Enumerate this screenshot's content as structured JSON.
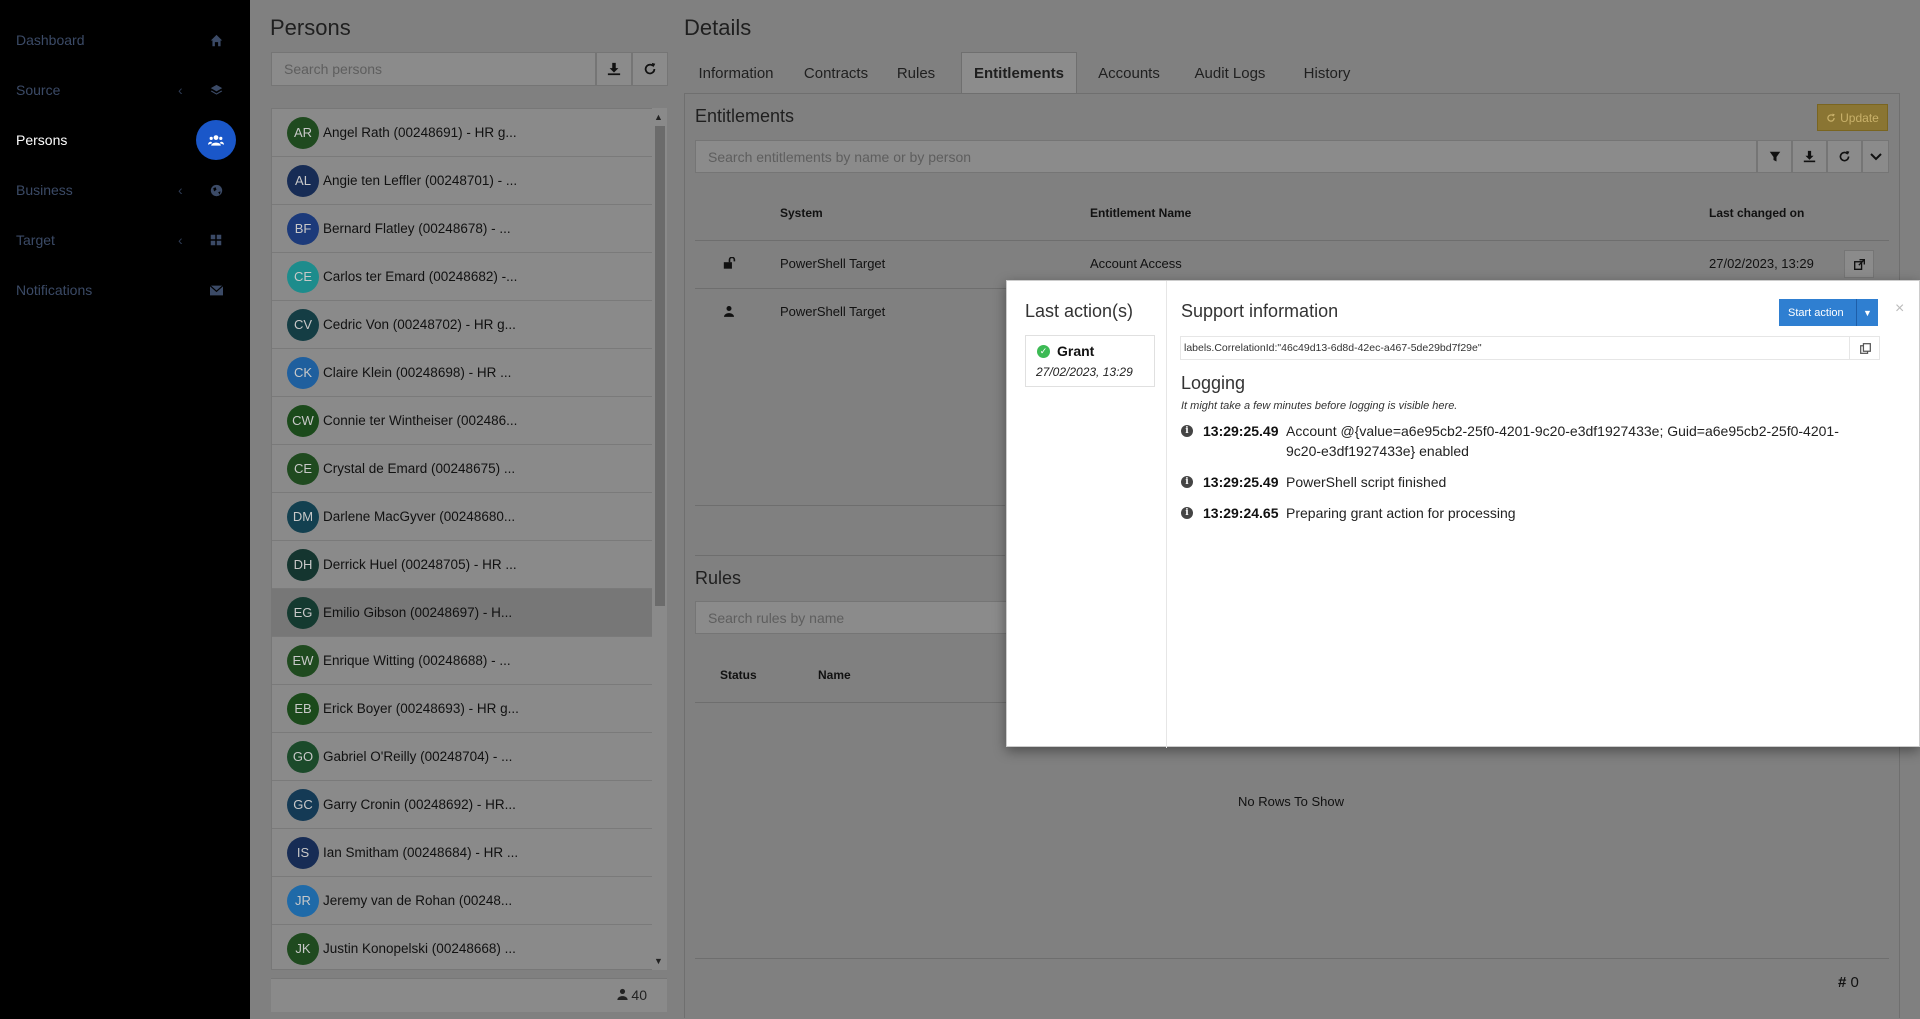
{
  "sidebar": {
    "items": [
      {
        "label": "Dashboard",
        "icon": "home-icon",
        "has_chevron": false
      },
      {
        "label": "Source",
        "icon": "layers-icon",
        "has_chevron": true
      },
      {
        "label": "Persons",
        "icon": "users-icon",
        "has_chevron": false,
        "active": true
      },
      {
        "label": "Business",
        "icon": "globe-icon",
        "has_chevron": true
      },
      {
        "label": "Target",
        "icon": "grid-icon",
        "has_chevron": true
      },
      {
        "label": "Notifications",
        "icon": "envelope-icon",
        "has_chevron": false
      }
    ],
    "chevron": "‹"
  },
  "persons": {
    "title": "Persons",
    "search_placeholder": "Search persons",
    "count": "40",
    "list": [
      {
        "initials": "AR",
        "name": "Angel Rath (00248691) - HR g...",
        "color": "#1f4a1f"
      },
      {
        "initials": "AL",
        "name": "Angie ten Leffler (00248701) - ...",
        "color": "#172c55"
      },
      {
        "initials": "BF",
        "name": "Bernard Flatley (00248678) - ...",
        "color": "#1c3a7a"
      },
      {
        "initials": "CE",
        "name": "Carlos ter Emard (00248682) -...",
        "color": "#1d8c8c"
      },
      {
        "initials": "CV",
        "name": "Cedric Von (00248702) - HR g...",
        "color": "#143d44"
      },
      {
        "initials": "CK",
        "name": "Claire Klein (00248698) - HR ...",
        "color": "#1f5f9e"
      },
      {
        "initials": "CW",
        "name": "Connie ter Wintheiser (002486...",
        "color": "#1b4a1b"
      },
      {
        "initials": "CE",
        "name": "Crystal de Emard (00248675) ...",
        "color": "#1f4a1f"
      },
      {
        "initials": "DM",
        "name": "Darlene MacGyver (00248680...",
        "color": "#134050"
      },
      {
        "initials": "DH",
        "name": "Derrick Huel (00248705) - HR ...",
        "color": "#14352f"
      },
      {
        "initials": "EG",
        "name": "Emilio Gibson (00248697) - H...",
        "color": "#143a30",
        "selected": true
      },
      {
        "initials": "EW",
        "name": "Enrique Witting (00248688) - ...",
        "color": "#1f4a1f"
      },
      {
        "initials": "EB",
        "name": "Erick Boyer (00248693) - HR g...",
        "color": "#1b4a1b"
      },
      {
        "initials": "GO",
        "name": "Gabriel O'Reilly (00248704) - ...",
        "color": "#1b4a2a"
      },
      {
        "initials": "GC",
        "name": "Garry Cronin (00248692) - HR...",
        "color": "#143a55"
      },
      {
        "initials": "IS",
        "name": "Ian Smitham (00248684) - HR ...",
        "color": "#172c55"
      },
      {
        "initials": "JR",
        "name": "Jeremy van de Rohan (00248...",
        "color": "#1f6aa8"
      },
      {
        "initials": "JK",
        "name": "Justin Konopelski (00248668) ...",
        "color": "#1f4a1f"
      }
    ]
  },
  "details": {
    "title": "Details",
    "tabs": [
      "Information",
      "Contracts",
      "Rules",
      "Entitlements",
      "Accounts",
      "Audit Logs",
      "History"
    ],
    "active_tab": "Entitlements",
    "entitlements": {
      "title": "Entitlements",
      "update_label": "Update",
      "search_placeholder": "Search entitlements by name or by person",
      "columns": [
        "System",
        "Entitlement Name",
        "Last changed on"
      ],
      "rows": [
        {
          "icon": "unlock-icon",
          "system": "PowerShell Target",
          "name": "Account Access",
          "changed": "27/02/2023, 13:29"
        },
        {
          "icon": "user-icon",
          "system": "PowerShell Target",
          "name": "",
          "changed": ""
        }
      ]
    },
    "rules": {
      "title": "Rules",
      "search_placeholder": "Search rules by name",
      "columns": [
        "Status",
        "Name"
      ],
      "empty_text": "No Rows To Show",
      "count": "0"
    }
  },
  "modal": {
    "last_actions_title": "Last action(s)",
    "grant": {
      "label": "Grant",
      "date": "27/02/2023, 13:29"
    },
    "support_title": "Support information",
    "start_action_label": "Start action",
    "close_label": "×",
    "correlation": "labels.CorrelationId:\"46c49d13-6d8d-42ec-a467-5de29bd7f29e\"",
    "logging_title": "Logging",
    "logging_hint": "It might take a few minutes before logging is visible here.",
    "logs": [
      {
        "time": "13:29:25.49",
        "message": "Account @{value=a6e95cb2-25f0-4201-9c20-e3df1927433e; Guid=a6e95cb2-25f0-4201-9c20-e3df1927433e} enabled"
      },
      {
        "time": "13:29:25.49",
        "message": "PowerShell script finished"
      },
      {
        "time": "13:29:24.65",
        "message": "Preparing grant action for processing"
      }
    ]
  }
}
